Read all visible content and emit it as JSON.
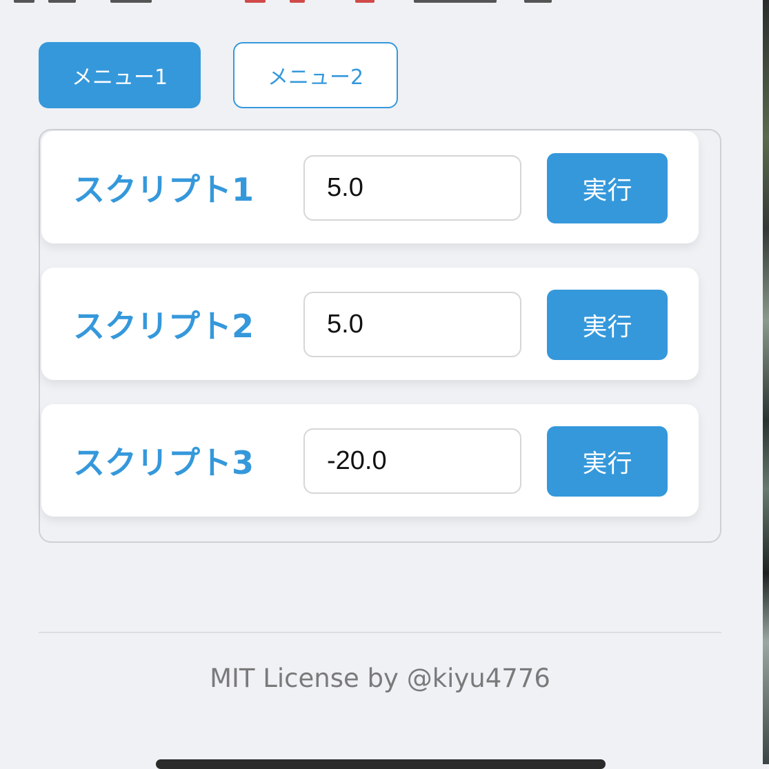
{
  "colors": {
    "accent": "#3598db",
    "background": "#eff1f5",
    "card": "#ffffff",
    "footer_text": "#7a7a7a"
  },
  "menu": {
    "tabs": [
      {
        "label": "メニュー1",
        "active": true
      },
      {
        "label": "メニュー2",
        "active": false
      }
    ]
  },
  "scripts": [
    {
      "label": "スクリプト1",
      "value": "5.0",
      "button": "実行"
    },
    {
      "label": "スクリプト2",
      "value": "5.0",
      "button": "実行"
    },
    {
      "label": "スクリプト3",
      "value": "-20.0",
      "button": "実行"
    }
  ],
  "footer": {
    "text": "MIT License by @kiyu4776"
  }
}
